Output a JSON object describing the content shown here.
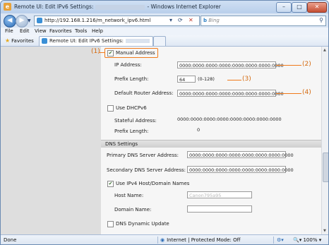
{
  "window": {
    "title_prefix": "Remote UI: Edit IPv6 Settings:",
    "title_suffix": "- Windows Internet Explorer",
    "min_label": "–",
    "max_label": "□",
    "close_label": "✕"
  },
  "address_bar": {
    "url": "http://192.168.1.216/m_network_ipv6.html",
    "search_placeholder": "Bing"
  },
  "menu": [
    "File",
    "Edit",
    "View",
    "Favorites",
    "Tools",
    "Help"
  ],
  "favorites_bar": {
    "favorites_label": "Favorites",
    "tab_label": "Remote UI: Edit IPv6 Settings:"
  },
  "form": {
    "manual_address": {
      "label": "Manual Address",
      "checked": true
    },
    "ip_address": {
      "label": "IP Address:",
      "value": "0000:0000:0000:0000:0000:0000:0000:0000"
    },
    "prefix_length": {
      "label": "Prefix Length:",
      "value": "64",
      "hint": "(0-128)"
    },
    "default_router": {
      "label": "Default Router Address:",
      "value": "0000:0000:0000:0000:0000:0000:0000:0000"
    },
    "use_dhcpv6": {
      "label": "Use DHCPv6",
      "checked": false
    },
    "stateful_address": {
      "label": "Stateful Address:",
      "value": "0000:0000:0000:0000:0000:0000:0000:0000"
    },
    "stateful_prefix": {
      "label": "Prefix Length:",
      "value": "0"
    },
    "dns_section": "DNS Settings",
    "primary_dns": {
      "label": "Primary DNS Server Address:",
      "value": "0000:0000:0000:0000:0000:0000:0000:0000"
    },
    "secondary_dns": {
      "label": "Secondary DNS Server Address:",
      "value": "0000:0000:0000:0000:0000:0000:0000:0000"
    },
    "use_ipv4_host": {
      "label": "Use IPv4 Host/Domain Names",
      "checked": true
    },
    "host_name": {
      "label": "Host Name:",
      "value": "Canon795a95"
    },
    "domain_name": {
      "label": "Domain Name:",
      "value": ""
    },
    "dns_dynamic_update": {
      "label": "DNS Dynamic Update",
      "checked": false
    }
  },
  "callouts": [
    "(1)",
    "(2)",
    "(3)",
    "(4)"
  ],
  "status_bar": {
    "left": "Done",
    "zone": "Internet | Protected Mode: Off",
    "zoom": "100%"
  },
  "colors": {
    "highlight": "#f07a1a",
    "chrome": "#dbe6f4"
  },
  "icons": [
    "app-icon",
    "back-icon",
    "forward-icon",
    "favicon",
    "refresh-icon",
    "stop-icon",
    "bing-icon",
    "search-icon",
    "favorites-star-icon",
    "tab-favicon",
    "globe-icon"
  ]
}
